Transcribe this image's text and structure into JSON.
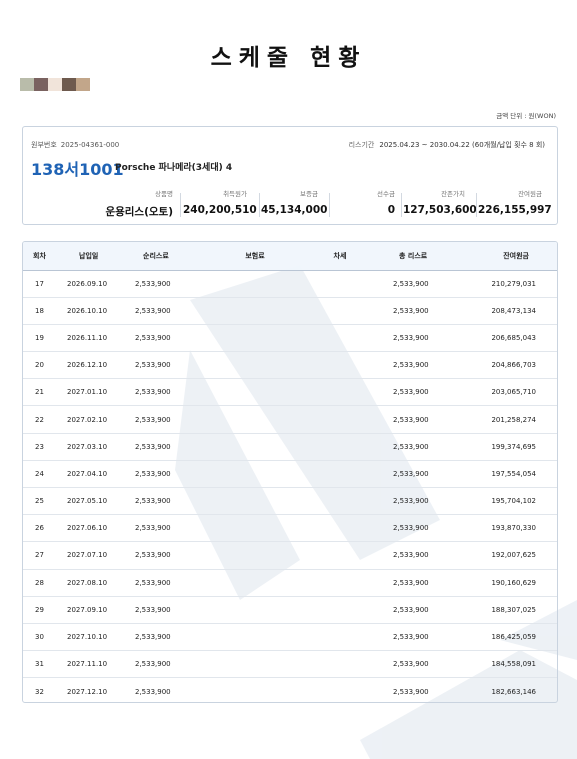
{
  "title": "스케줄 현황",
  "swatch_colors": [
    "#b9bcaa",
    "#7a6260",
    "#f1e4da",
    "#6e5a4e",
    "#c2a68a"
  ],
  "unit_note": "금액 단위 : 원(WON)",
  "contract": {
    "number_label": "원부번호",
    "number": "2025-04361-000",
    "period_label": "리스기간",
    "period": "2025.04.23 ~ 2030.04.22 (60개월/납입 횟수 8 회)",
    "plate": "138서1001",
    "car": "Porsche 파나메라(3세대) 4"
  },
  "fields": [
    {
      "label": "상품명",
      "value": "운용리스(오토)"
    },
    {
      "label": "취득원가",
      "value": "240,200,510"
    },
    {
      "label": "보증금",
      "value": "45,134,000"
    },
    {
      "label": "선수금",
      "value": "0"
    },
    {
      "label": "잔존가치",
      "value": "127,503,600"
    },
    {
      "label": "잔여원금",
      "value": "226,155,997"
    }
  ],
  "schedule": {
    "headers": [
      "회차",
      "납입일",
      "순리스료",
      "보험료",
      "차세",
      "총 리스료",
      "잔여원금"
    ],
    "rows": [
      [
        "17",
        "2026.09.10",
        "2,533,900",
        "",
        "",
        "2,533,900",
        "210,279,031"
      ],
      [
        "18",
        "2026.10.10",
        "2,533,900",
        "",
        "",
        "2,533,900",
        "208,473,134"
      ],
      [
        "19",
        "2026.11.10",
        "2,533,900",
        "",
        "",
        "2,533,900",
        "206,685,043"
      ],
      [
        "20",
        "2026.12.10",
        "2,533,900",
        "",
        "",
        "2,533,900",
        "204,866,703"
      ],
      [
        "21",
        "2027.01.10",
        "2,533,900",
        "",
        "",
        "2,533,900",
        "203,065,710"
      ],
      [
        "22",
        "2027.02.10",
        "2,533,900",
        "",
        "",
        "2,533,900",
        "201,258,274"
      ],
      [
        "23",
        "2027.03.10",
        "2,533,900",
        "",
        "",
        "2,533,900",
        "199,374,695"
      ],
      [
        "24",
        "2027.04.10",
        "2,533,900",
        "",
        "",
        "2,533,900",
        "197,554,054"
      ],
      [
        "25",
        "2027.05.10",
        "2,533,900",
        "",
        "",
        "2,533,900",
        "195,704,102"
      ],
      [
        "26",
        "2027.06.10",
        "2,533,900",
        "",
        "",
        "2,533,900",
        "193,870,330"
      ],
      [
        "27",
        "2027.07.10",
        "2,533,900",
        "",
        "",
        "2,533,900",
        "192,007,625"
      ],
      [
        "28",
        "2027.08.10",
        "2,533,900",
        "",
        "",
        "2,533,900",
        "190,160,629"
      ],
      [
        "29",
        "2027.09.10",
        "2,533,900",
        "",
        "",
        "2,533,900",
        "188,307,025"
      ],
      [
        "30",
        "2027.10.10",
        "2,533,900",
        "",
        "",
        "2,533,900",
        "186,425,059"
      ],
      [
        "31",
        "2027.11.10",
        "2,533,900",
        "",
        "",
        "2,533,900",
        "184,558,091"
      ],
      [
        "32",
        "2027.12.10",
        "2,533,900",
        "",
        "",
        "2,533,900",
        "182,663,146"
      ]
    ]
  }
}
